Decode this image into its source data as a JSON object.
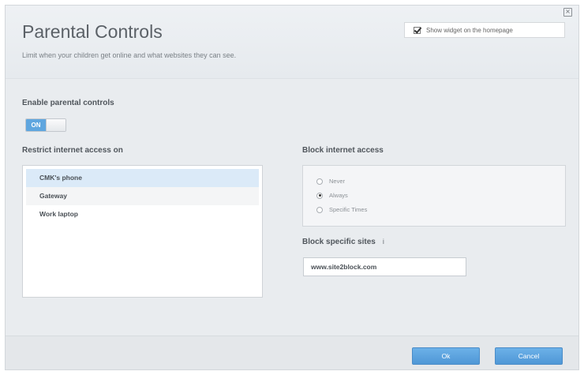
{
  "header": {
    "title": "Parental Controls",
    "subtitle": "Limit when your children get online and what websites they can see.",
    "close_glyph": "×",
    "widget_checkbox": {
      "label": "Show widget on the homepage",
      "checked": true
    }
  },
  "enable": {
    "label": "Enable parental controls",
    "toggle_text": "ON",
    "accent": "#5fa6df"
  },
  "restrict": {
    "label": "Restrict internet access on",
    "devices": [
      "CMK's phone",
      "Gateway",
      "Work laptop"
    ]
  },
  "block_access": {
    "label": "Block internet access",
    "options": [
      "Never",
      "Always",
      "Specific Times"
    ],
    "selected": "Always"
  },
  "block_sites": {
    "label": "Block specific sites",
    "info_glyph": "i",
    "value": "www.site2block.com"
  },
  "footer": {
    "ok_label": "Ok",
    "cancel_label": "Cancel",
    "button_color": "#5fa6df"
  }
}
